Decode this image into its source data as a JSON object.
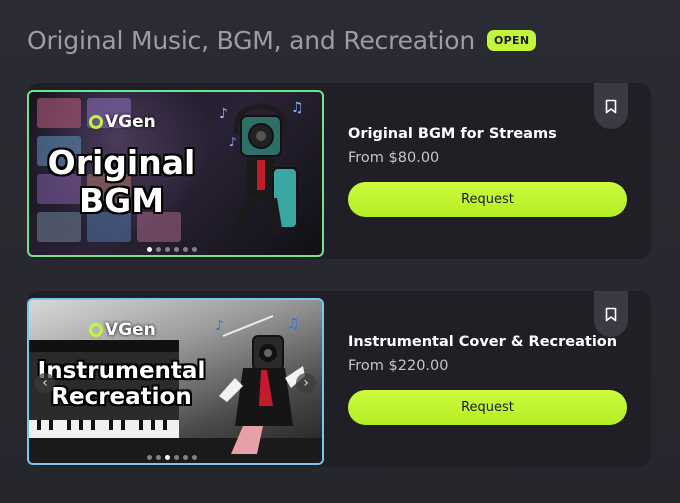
{
  "section": {
    "title": "Original Music, BGM, and Recreation",
    "badge": "OPEN"
  },
  "items": [
    {
      "title": "Original BGM for Streams",
      "price": "From $80.00",
      "button_label": "Request",
      "thumbnail": {
        "brand": "VGen",
        "line1": "Original",
        "line2": "BGM",
        "dots": 6,
        "active_dot": 0
      }
    },
    {
      "title": "Instrumental Cover & Recreation",
      "price": "From $220.00",
      "button_label": "Request",
      "thumbnail": {
        "brand": "VGen",
        "line1": "Instrumental",
        "line2": "Recreation",
        "dots": 6,
        "active_dot": 2
      }
    }
  ],
  "icons": {
    "bookmark": "bookmark-icon",
    "prev": "chevron-left-icon",
    "next": "chevron-right-icon"
  },
  "colors": {
    "accent": "#c3f53a",
    "card_bg": "#1f1f25",
    "page_bg": "#2a2a32",
    "thumb_border_1": "#72e38c",
    "thumb_border_2": "#72c8ef"
  }
}
